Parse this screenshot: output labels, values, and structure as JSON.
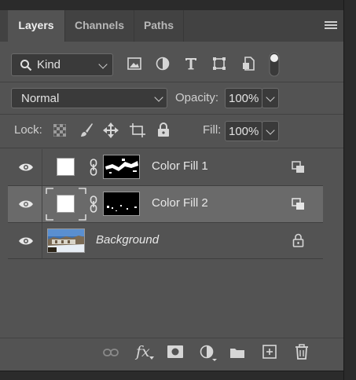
{
  "tabs": [
    {
      "label": "Layers",
      "active": true
    },
    {
      "label": "Channels",
      "active": false
    },
    {
      "label": "Paths",
      "active": false
    }
  ],
  "filter": {
    "kind_label": "Kind"
  },
  "blend": {
    "mode": "Normal",
    "opacity_label": "Opacity:",
    "opacity_value": "100%"
  },
  "lock": {
    "label": "Lock:",
    "fill_label": "Fill:",
    "fill_value": "100%"
  },
  "layers": [
    {
      "name": "Color Fill 1",
      "selected": false,
      "italic": false
    },
    {
      "name": "Color Fill 2",
      "selected": true,
      "italic": false
    },
    {
      "name": "Background",
      "selected": false,
      "italic": true,
      "locked": true
    }
  ],
  "footer": {
    "fx_label": "fx"
  },
  "colors": {
    "panel_bg": "#535353",
    "tab_bg": "#424242",
    "selected_row": "#6a6a6a",
    "field_bg": "#3a3a3a"
  },
  "icons": [
    "menu-icon",
    "search-icon",
    "image-filter-icon",
    "adjustment-filter-icon",
    "type-filter-icon",
    "shape-filter-icon",
    "smart-object-filter-icon",
    "filter-toggle-icon",
    "lock-pixels-icon",
    "lock-brush-icon",
    "lock-move-icon",
    "lock-artboard-icon",
    "lock-all-icon",
    "eye-icon",
    "chain-link-icon",
    "smart-filter-icon",
    "padlock-icon",
    "link-layers-icon",
    "fx-icon",
    "mask-icon",
    "adjustment-layer-icon",
    "folder-icon",
    "new-layer-icon",
    "trash-icon"
  ]
}
